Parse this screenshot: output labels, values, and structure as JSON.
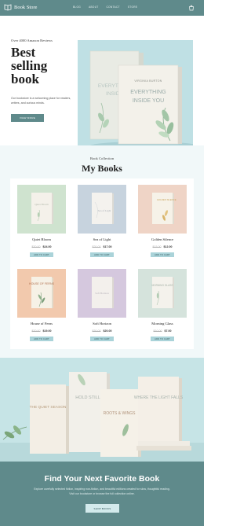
{
  "header": {
    "logo_text": "Book Store",
    "nav": [
      "BLOG",
      "ABOUT",
      "CONTACT",
      "STORE"
    ]
  },
  "hero": {
    "kicker": "Over 4000 Amazon Reviews",
    "title": "Best selling book",
    "description": "Our bookstore is a welcoming place for readers, writers, and curious minds.",
    "button": "VIEW MORE",
    "book_front_author": "VIRGINIA BURTON",
    "book_front_title_1": "EVERYTHING",
    "book_front_title_2": "INSIDE YOU",
    "book_back_title_1": "EVERYTHING",
    "book_back_title_2": "INSIDE"
  },
  "collection": {
    "kicker": "Book Collection",
    "title": "My Books",
    "books": [
      {
        "title": "Quiet Bloom",
        "old_price": "$30.00",
        "price": "$24.00",
        "button": "ADD TO CART",
        "cover_text": "Quiet Bloom"
      },
      {
        "title": "Sea of Light",
        "old_price": "$20.00",
        "price": "$17.00",
        "button": "ADD TO CART",
        "cover_text": "Sea of Light"
      },
      {
        "title": "Golden Silence",
        "old_price": "$15.00",
        "price": "$12.00",
        "button": "ADD TO CART",
        "cover_text": "GOLDEN SILENCE"
      },
      {
        "title": "House of Ferns",
        "old_price": "$20.00",
        "price": "$19.00",
        "button": "ADD TO CART",
        "cover_text": "HOUSE OF FERNS"
      },
      {
        "title": "Soft Horizon",
        "old_price": "$30.00",
        "price": "$20.00",
        "button": "ADD TO CART",
        "cover_text": "Soft Horizon"
      },
      {
        "title": "Morning Glass",
        "old_price": "$10.00",
        "price": "$7.00",
        "button": "ADD TO CART",
        "cover_text": "MORNING GLASS"
      }
    ]
  },
  "banner": {
    "books": [
      "THE QUIET SEASON",
      "HOLD STILL",
      "ROOTS & WINGS",
      "WHERE THE LIGHT FALLS"
    ]
  },
  "cta": {
    "title": "Find Your Next Favorite Book",
    "description_1": "Explore carefully selected fiction, inspiring non-fiction, and beautiful editions created for slow, thoughtful reading.",
    "description_2": "Visit our bookstore or browse the full collection online.",
    "button": "SHOP BOOKS"
  },
  "colors": {
    "primary": "#5f8a8b",
    "button_light": "#aad3d9",
    "section_bg": "#f1f8f9"
  }
}
